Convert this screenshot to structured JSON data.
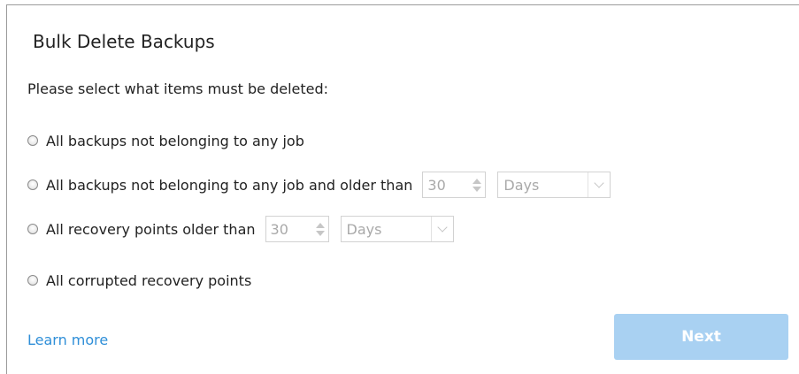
{
  "dialog": {
    "title": "Bulk Delete Backups",
    "prompt": "Please select what items must be deleted:"
  },
  "options": [
    {
      "label": "All backups not belonging to any job"
    },
    {
      "label": "All backups not belonging to any job and older than",
      "spinner_value": "30",
      "unit": "Days"
    },
    {
      "label": "All recovery points older than",
      "spinner_value": "30",
      "unit": "Days"
    },
    {
      "label": "All corrupted recovery points"
    }
  ],
  "footer": {
    "learn_more": "Learn more",
    "next_label": "Next"
  },
  "colors": {
    "link": "#2f8fd8",
    "next_button_bg": "#a9d1f2",
    "disabled_text": "#a9a9a9"
  },
  "icons": {
    "radio": "radio-button-unselected",
    "spinner": "up-down-arrows",
    "dropdown": "chevron-down"
  }
}
